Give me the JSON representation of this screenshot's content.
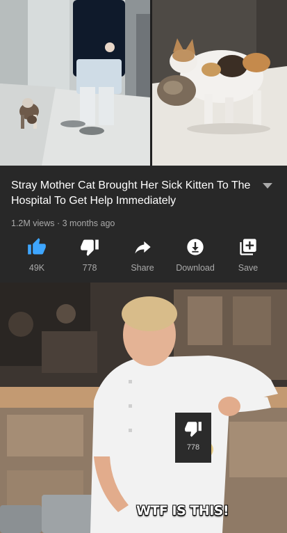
{
  "video": {
    "title": "Stray Mother Cat Brought Her Sick Kitten To The Hospital To Get Help Immediately",
    "meta": "1.2M views · 3 months ago"
  },
  "actions": [
    {
      "icon": "thumbs-up-icon",
      "label": "49K",
      "color": "#3ea6ff"
    },
    {
      "icon": "thumbs-down-icon",
      "label": "778",
      "color": "#ffffff"
    },
    {
      "icon": "share-icon",
      "label": "Share",
      "color": "#ffffff"
    },
    {
      "icon": "download-icon",
      "label": "Download",
      "color": "#ffffff"
    },
    {
      "icon": "save-icon",
      "label": "Save",
      "color": "#ffffff"
    }
  ],
  "meme": {
    "dislike_count": "778",
    "caption": "WTF IS THIS!"
  },
  "colors": {
    "panel_background": "#282828",
    "like_accent": "#3ea6ff",
    "secondary_text": "#aaaaaa"
  }
}
